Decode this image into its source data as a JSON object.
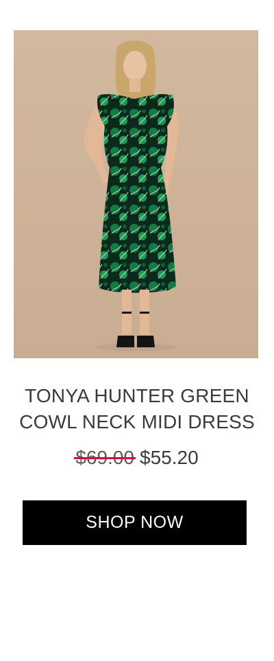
{
  "product": {
    "image_alt": "Woman wearing green floral cowl neck midi dress",
    "title_line1": "TONYA HUNTER GREEN",
    "title_line2": "COWL NECK MIDI DRESS",
    "price_original": "$69.00",
    "price_sale": "$55.20"
  },
  "cta": {
    "label": "SHOP NOW"
  },
  "colors": {
    "background": "#ffffff",
    "text": "#3a3a3a",
    "strike": "#d0103a",
    "button_bg": "#000000",
    "button_text": "#ffffff",
    "photo_backdrop": "#cfb59c",
    "dress_green": "#0f7a4a"
  }
}
